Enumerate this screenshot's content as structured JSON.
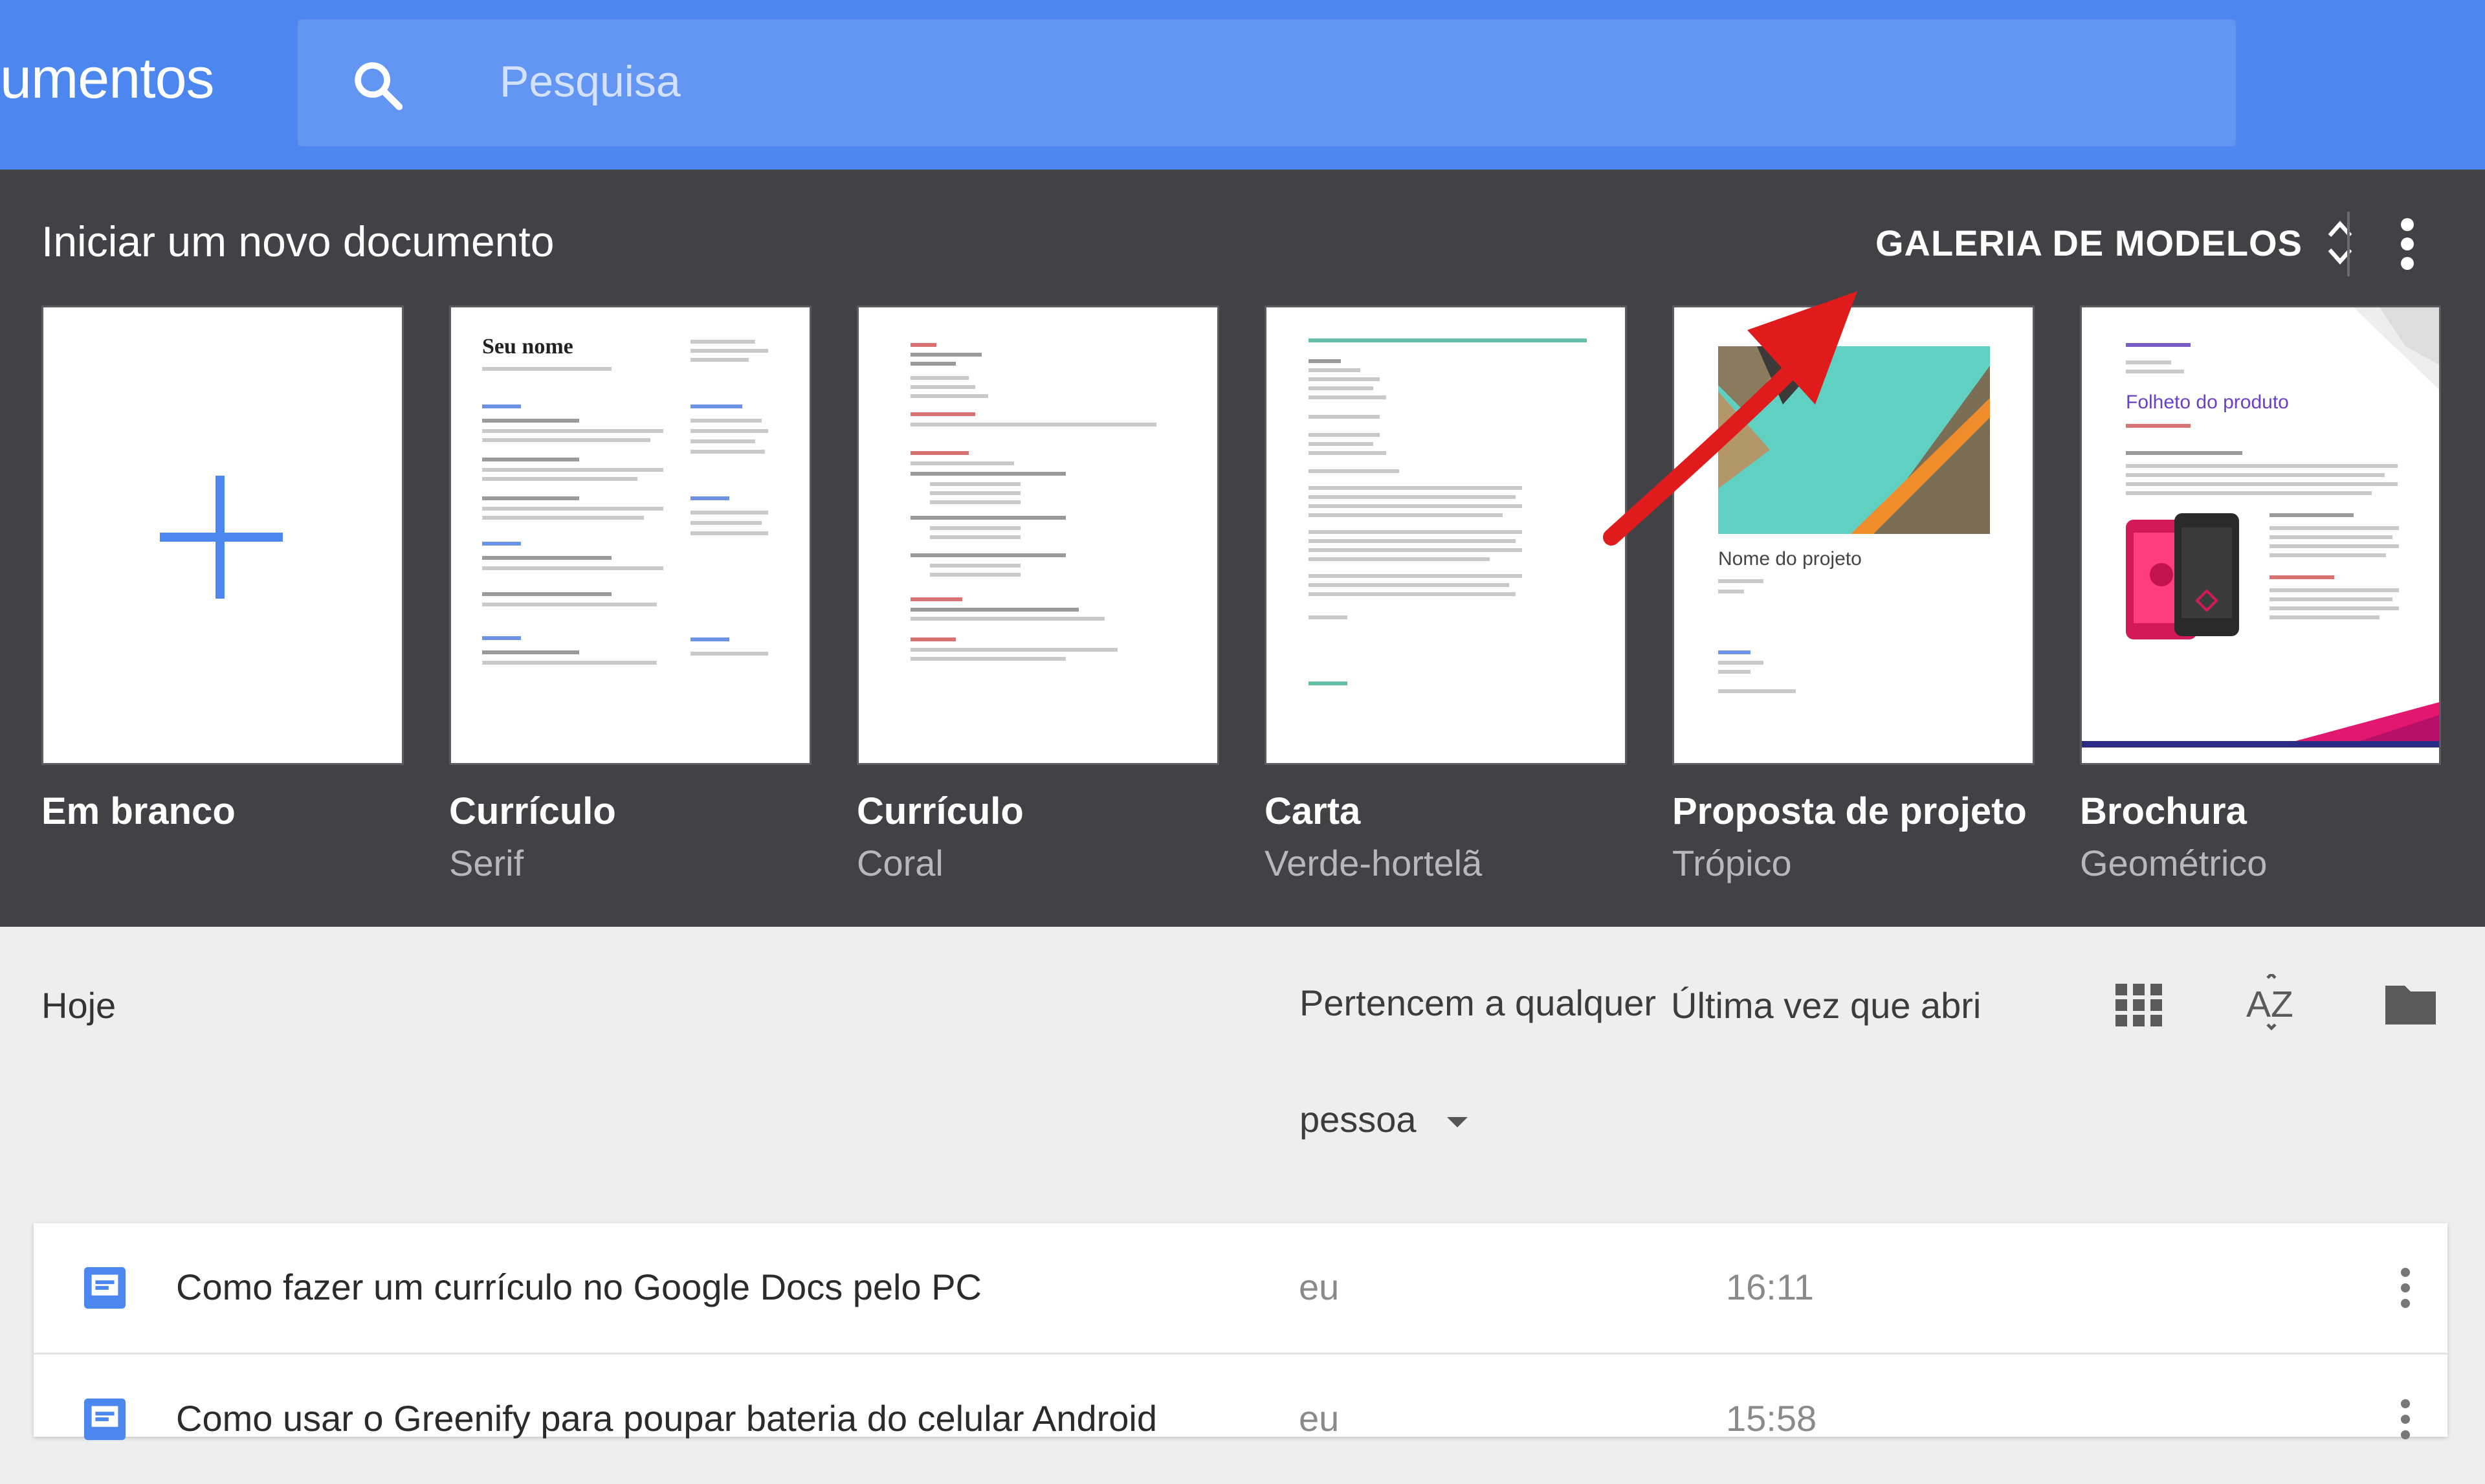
{
  "header": {
    "app_title": "umentos",
    "search_placeholder": "Pesquisa"
  },
  "gallery": {
    "title": "Iniciar um novo documento",
    "toggle_label": "GALERIA DE MODELOS",
    "templates": [
      {
        "name": "Em branco",
        "subtitle": ""
      },
      {
        "name": "Currículo",
        "subtitle": "Serif",
        "heading": "Seu nome"
      },
      {
        "name": "Currículo",
        "subtitle": "Coral"
      },
      {
        "name": "Carta",
        "subtitle": "Verde-hortelã"
      },
      {
        "name": "Proposta de projeto",
        "subtitle": "Trópico",
        "heading": "Nome do projeto"
      },
      {
        "name": "Brochura",
        "subtitle": "Geométrico",
        "heading": "Folheto do produto"
      }
    ]
  },
  "list": {
    "section_label": "Hoje",
    "owner_filter": "Pertencem a qualquer pessoa",
    "sort_label": "Última vez que abri",
    "rows": [
      {
        "title": "Como fazer um currículo no Google Docs pelo PC",
        "owner": "eu",
        "time": "16:11"
      },
      {
        "title": "Como usar o Greenify para poupar bateria do celular Android",
        "owner": "eu",
        "time": "15:58"
      }
    ]
  },
  "colors": {
    "header": "#4c86ef",
    "gallery": "#424246",
    "doc_icon": "#4c86ef",
    "annotation_arrow": "#e01b1b"
  }
}
